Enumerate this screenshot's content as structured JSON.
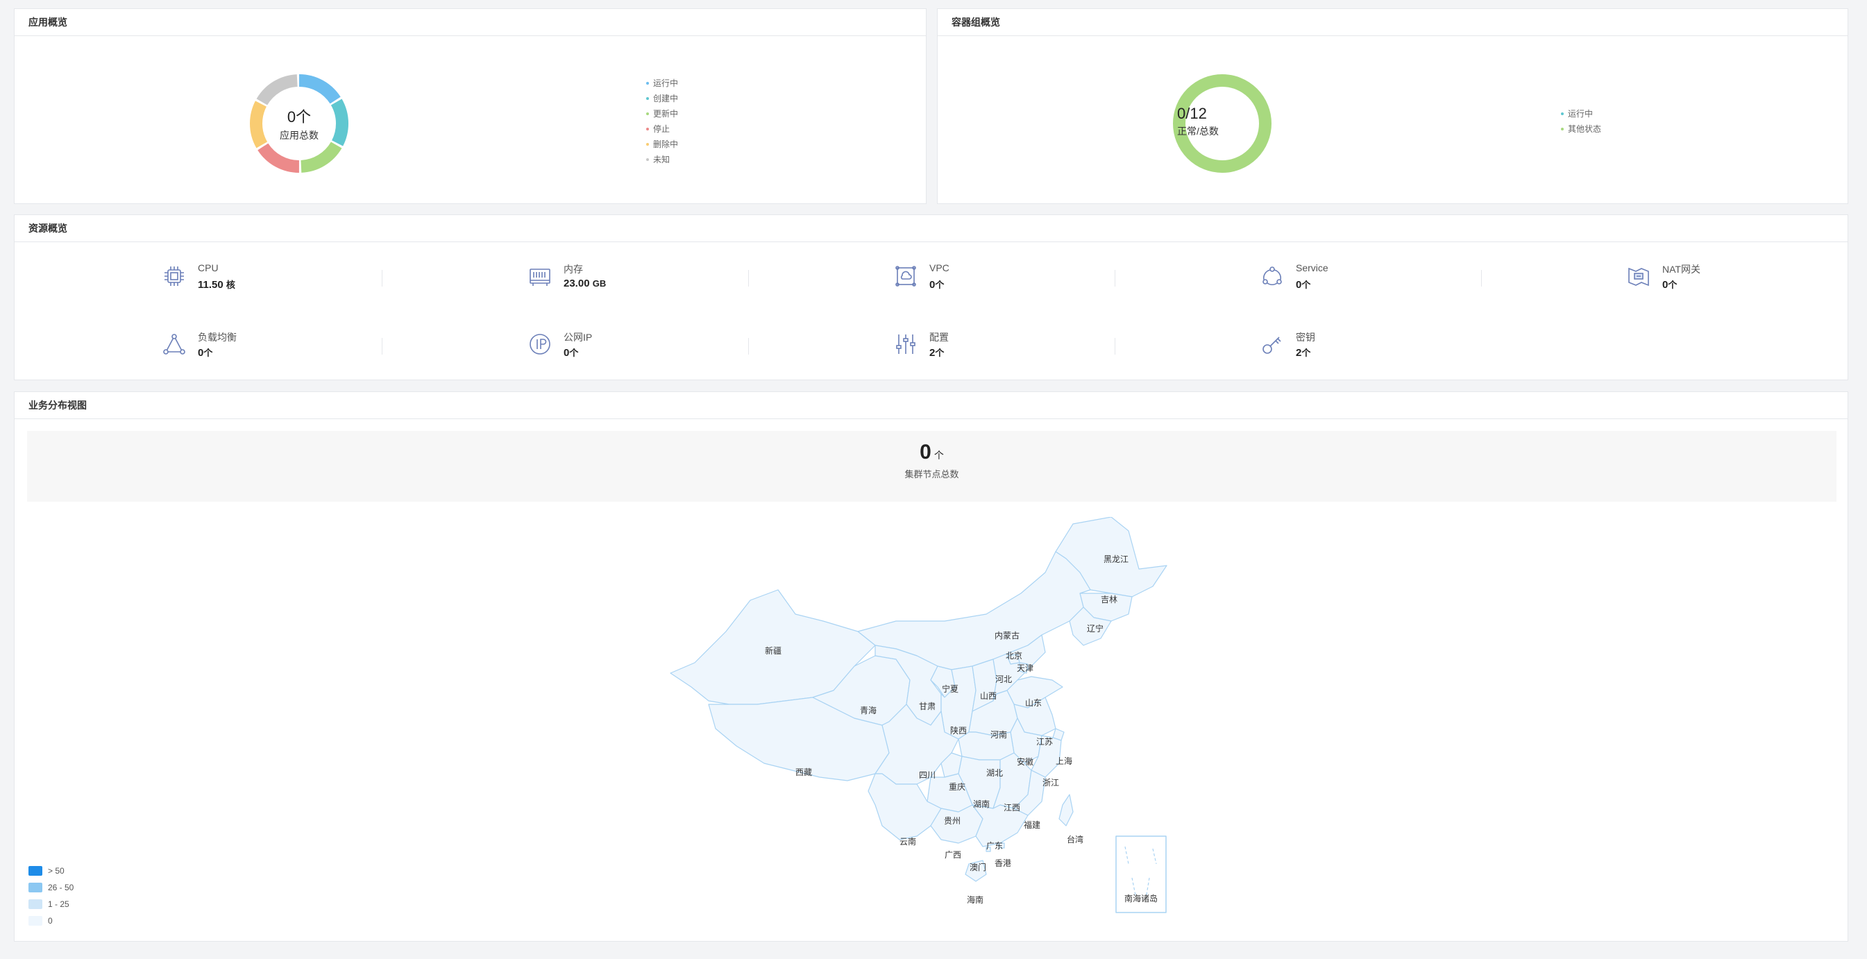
{
  "app_overview": {
    "title": "应用概览",
    "total_value": "0个",
    "total_label": "应用总数",
    "legend": [
      {
        "label": "运行中",
        "color": "#6cbdef"
      },
      {
        "label": "创建中",
        "color": "#5fc7d0"
      },
      {
        "label": "更新中",
        "color": "#a8d97f"
      },
      {
        "label": "停止",
        "color": "#ec8a8a"
      },
      {
        "label": "删除中",
        "color": "#f9cc72"
      },
      {
        "label": "未知",
        "color": "#c8c8c8"
      }
    ]
  },
  "pod_overview": {
    "title": "容器组概览",
    "total_value": "0/12",
    "total_label": "正常/总数",
    "legend": [
      {
        "label": "运行中",
        "color": "#5fc7d0"
      },
      {
        "label": "其他状态",
        "color": "#a8d97f"
      }
    ]
  },
  "resource_overview": {
    "title": "资源概览",
    "items": [
      {
        "name": "CPU",
        "value": "11.50",
        "unit": "核",
        "icon": "cpu-icon"
      },
      {
        "name": "内存",
        "value": "23.00",
        "unit": "GB",
        "icon": "memory-icon"
      },
      {
        "name": "VPC",
        "value": "0",
        "unit": "个",
        "icon": "vpc-icon"
      },
      {
        "name": "Service",
        "value": "0",
        "unit": "个",
        "icon": "service-icon"
      },
      {
        "name": "NAT网关",
        "value": "0",
        "unit": "个",
        "icon": "nat-gateway-icon"
      },
      {
        "name": "负载均衡",
        "value": "0",
        "unit": "个",
        "icon": "load-balancer-icon"
      },
      {
        "name": "公网IP",
        "value": "0",
        "unit": "个",
        "icon": "public-ip-icon"
      },
      {
        "name": "配置",
        "value": "2",
        "unit": "个",
        "icon": "config-icon"
      },
      {
        "name": "密钥",
        "value": "2",
        "unit": "个",
        "icon": "key-icon"
      }
    ]
  },
  "distribution": {
    "title": "业务分布视图",
    "node_total": "0",
    "node_unit": "个",
    "node_label": "集群节点总数",
    "map_legend": [
      {
        "label": "> 50",
        "color": "#1e8ce8"
      },
      {
        "label": "26 - 50",
        "color": "#8cc8f2"
      },
      {
        "label": "1 - 25",
        "color": "#cfe6f8"
      },
      {
        "label": "0",
        "color": "#eef6fd"
      }
    ],
    "provinces": [
      "黑龙江",
      "吉林",
      "辽宁",
      "内蒙古",
      "北京",
      "天津",
      "河北",
      "新疆",
      "宁夏",
      "山西",
      "山东",
      "青海",
      "甘肃",
      "陕西",
      "河南",
      "江苏",
      "上海",
      "西藏",
      "四川",
      "湖北",
      "安徽",
      "重庆",
      "浙江",
      "湖南",
      "江西",
      "贵州",
      "福建",
      "云南",
      "台湾",
      "广西",
      "广东",
      "澳门",
      "香港",
      "海南",
      "南海诸岛"
    ],
    "colors": {
      "fill": "#eef6fd",
      "stroke": "#a9d3f3"
    }
  }
}
